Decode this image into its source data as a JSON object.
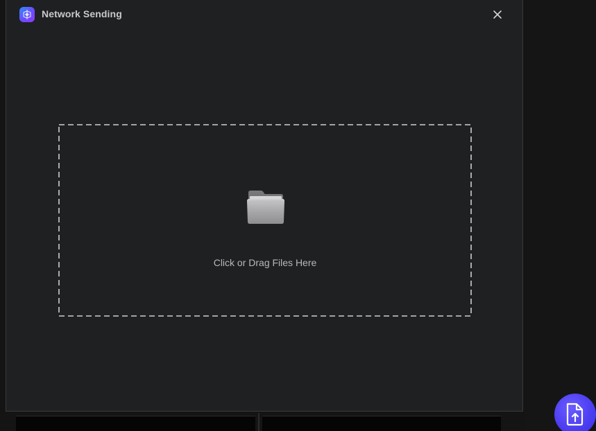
{
  "dialog": {
    "title": "Network Sending",
    "close_icon": "close-icon",
    "app_icon": "network-sending-app-icon"
  },
  "dropzone": {
    "label": "Click or Drag Files Here",
    "icon": "folder-icon"
  },
  "fab": {
    "icon": "file-upload-icon"
  },
  "colors": {
    "dialog_bg": "#1f2022",
    "accent": "#4a3cf0",
    "text": "#b8b8bb",
    "title": "#c9c9cc"
  }
}
